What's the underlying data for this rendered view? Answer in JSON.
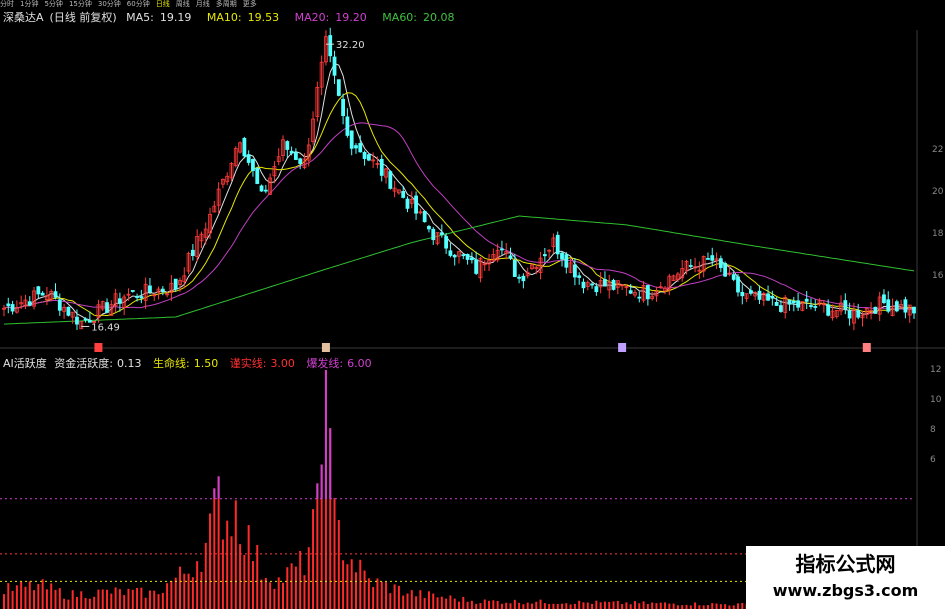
{
  "toolbar": {
    "items": [
      "分时",
      "1分钟",
      "5分钟",
      "15分钟",
      "30分钟",
      "60分钟",
      "日线",
      "周线",
      "月线",
      "多周期",
      "更多"
    ],
    "active_index": 6
  },
  "header": {
    "stock": "深桑达A",
    "period": "(日线 前复权)",
    "ma": [
      {
        "label": "MA5:",
        "value": "19.19",
        "color": "#e0e0e0"
      },
      {
        "label": "MA10:",
        "value": "19.53",
        "color": "#e8e800"
      },
      {
        "label": "MA20:",
        "value": "19.20",
        "color": "#d040d0"
      },
      {
        "label": "MA60:",
        "value": "20.08",
        "color": "#40c040"
      }
    ]
  },
  "sub_header": {
    "name": "AI活跃度",
    "items": [
      {
        "label": "资金活跃度:",
        "value": "0.13",
        "color": "#e0e0e0"
      },
      {
        "label": "生命线:",
        "value": "1.50",
        "color": "#e8e800"
      },
      {
        "label": "谨实线:",
        "value": "3.00",
        "color": "#ff3030"
      },
      {
        "label": "爆发线:",
        "value": "6.00",
        "color": "#d040d0"
      }
    ]
  },
  "colors": {
    "up": "#ff3b3b",
    "down": "#54ffff",
    "ma5": "#e0e0e0",
    "ma10": "#e8e800",
    "ma20": "#c040c0",
    "ma60": "#30c030",
    "bar": "#ff2a2a",
    "burst": "#d040d0"
  },
  "watermark": {
    "line1": "指标公式网",
    "line2": "www.zbgs3.com"
  },
  "chart_data": [
    {
      "type": "candlestick",
      "price_high_label": "32.20",
      "price_low_label": "16.49",
      "ylim": [
        15.5,
        33
      ],
      "right_ticks": [
        "22",
        "20",
        "18",
        "16"
      ],
      "markers": [
        "购",
        "购",
        "购"
      ],
      "ohlc_keypoints": [
        [
          0,
          17.3
        ],
        [
          10,
          18.2
        ],
        [
          18,
          16.49
        ],
        [
          28,
          18.0
        ],
        [
          40,
          18.5
        ],
        [
          48,
          22.5
        ],
        [
          55,
          27.0
        ],
        [
          60,
          23.5
        ],
        [
          65,
          26.5
        ],
        [
          70,
          25.5
        ],
        [
          75,
          32.2
        ],
        [
          80,
          27.0
        ],
        [
          90,
          24.5
        ],
        [
          100,
          21.5
        ],
        [
          110,
          19.5
        ],
        [
          115,
          21.0
        ],
        [
          120,
          19.0
        ],
        [
          128,
          21.0
        ],
        [
          135,
          18.8
        ],
        [
          142,
          18.5
        ],
        [
          150,
          18.2
        ],
        [
          158,
          19.5
        ],
        [
          165,
          20.0
        ],
        [
          172,
          18.0
        ],
        [
          180,
          17.5
        ],
        [
          190,
          17.4
        ],
        [
          198,
          17.0
        ],
        [
          205,
          17.6
        ],
        [
          212,
          17.2
        ]
      ],
      "ma60_keypoints": [
        [
          0,
          16.4
        ],
        [
          40,
          16.8
        ],
        [
          75,
          19.5
        ],
        [
          95,
          21.0
        ],
        [
          120,
          22.5
        ],
        [
          145,
          22.0
        ],
        [
          175,
          20.8
        ],
        [
          212,
          19.4
        ]
      ]
    },
    {
      "type": "bar",
      "ylim": [
        0,
        13
      ],
      "right_ticks": [
        "12",
        "10",
        "8",
        "6"
      ],
      "threshold_lines": [
        1.5,
        3.0,
        6.0
      ],
      "keypoints": [
        [
          0,
          1.2
        ],
        [
          8,
          1.5
        ],
        [
          15,
          0.9
        ],
        [
          25,
          1.1
        ],
        [
          35,
          1.0
        ],
        [
          43,
          2.5
        ],
        [
          47,
          4.0
        ],
        [
          50,
          7.0
        ],
        [
          52,
          5.8
        ],
        [
          54,
          6.5
        ],
        [
          56,
          5.0
        ],
        [
          60,
          2.5
        ],
        [
          64,
          1.8
        ],
        [
          70,
          3.0
        ],
        [
          73,
          6.0
        ],
        [
          75,
          13.0
        ],
        [
          77,
          5.5
        ],
        [
          80,
          3.5
        ],
        [
          85,
          1.8
        ],
        [
          95,
          1.0
        ],
        [
          110,
          0.5
        ],
        [
          140,
          0.4
        ],
        [
          170,
          0.3
        ],
        [
          212,
          0.2
        ]
      ]
    }
  ]
}
